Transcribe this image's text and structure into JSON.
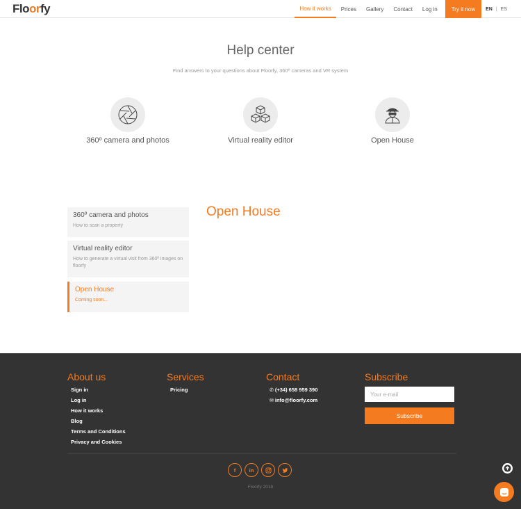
{
  "brand": {
    "logo_pre": "Flo",
    "logo_mid": "or",
    "logo_post": "fy",
    "accent": "#f47b20"
  },
  "nav": {
    "items": [
      "How it works",
      "Prices",
      "Gallery",
      "Contact",
      "Log in"
    ],
    "cta": "Try it now",
    "lang_en": "EN",
    "lang_sep": "|",
    "lang_es": "ES"
  },
  "hero": {
    "title": "Help center",
    "subtitle": "Find answers to your questions about Floorfy, 360º cameras and VR system"
  },
  "categories": [
    {
      "label": "360º camera and photos",
      "icon": "camera-shutter-icon"
    },
    {
      "label": "Virtual reality editor",
      "icon": "cubes-icon"
    },
    {
      "label": "Open House",
      "icon": "agent-icon"
    }
  ],
  "sidebar": {
    "items": [
      {
        "title": "360º camera and photos",
        "desc": "How to scan a property"
      },
      {
        "title": "Virtual reality editor",
        "desc": "How to generate a virtual visit from 360º images on floorfy"
      },
      {
        "title": "Open House",
        "desc": "Coming soon..."
      }
    ],
    "active_index": 2
  },
  "content": {
    "title": "Open House"
  },
  "footer": {
    "about": {
      "title": "About us",
      "links": [
        "Sign in",
        "Log in",
        "How it works",
        "Blog",
        "Terms and Conditions",
        "Privacy and Cookies"
      ]
    },
    "services": {
      "title": "Services",
      "links": [
        "Pricing"
      ]
    },
    "contact": {
      "title": "Contact",
      "phone": "(+34) 658 959 390",
      "email": "info@floorfy.com"
    },
    "subscribe": {
      "title": "Subscribe",
      "placeholder": "Your e-mail",
      "button": "Subscribe"
    },
    "social": [
      "f",
      "in",
      "ig",
      "tw"
    ],
    "copyright": "Floorfy 2018"
  }
}
